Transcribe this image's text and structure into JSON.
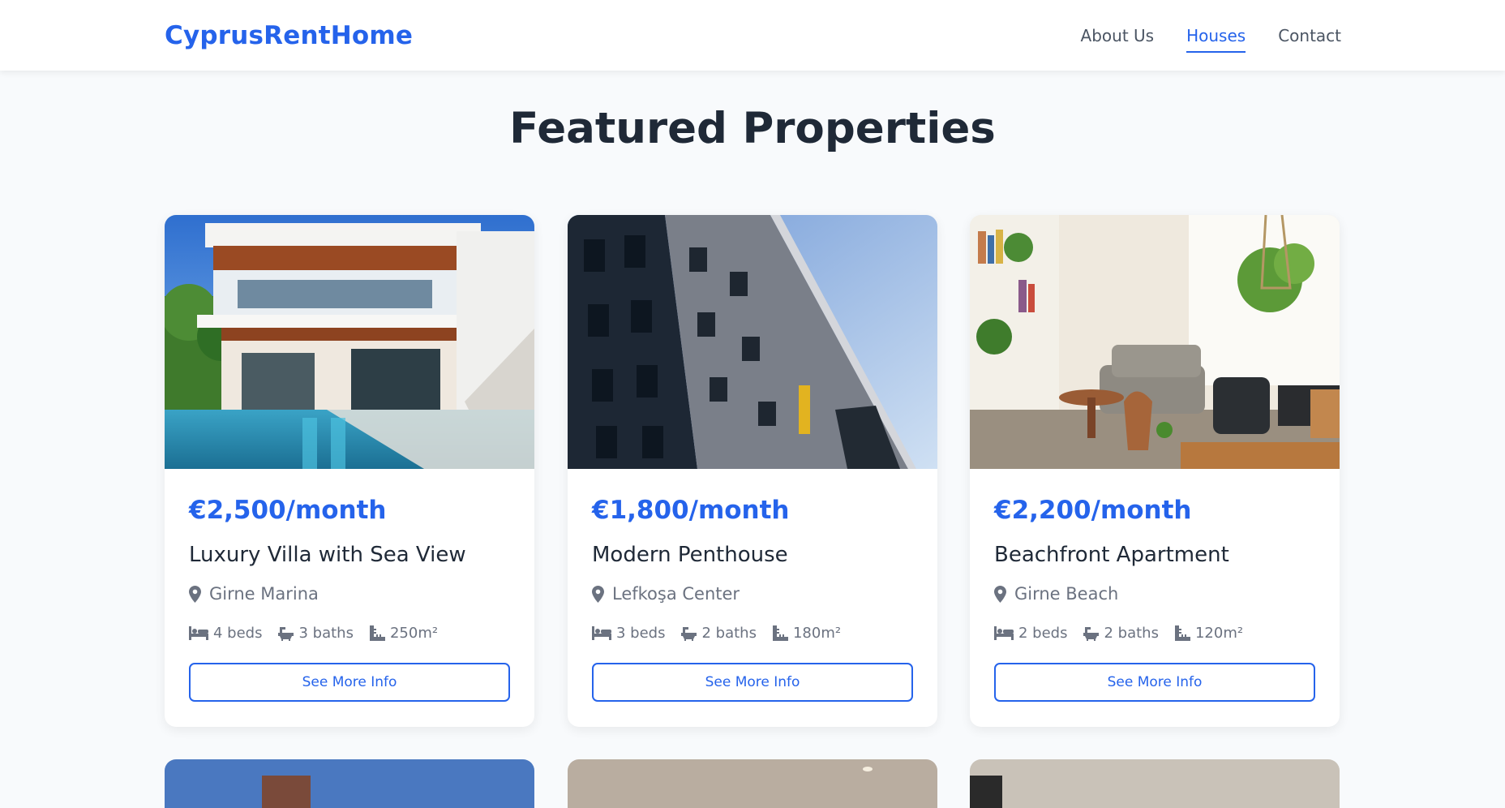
{
  "header": {
    "brand": "CyprusRentHome",
    "nav": [
      {
        "label": "About Us",
        "active": false
      },
      {
        "label": "Houses",
        "active": true
      },
      {
        "label": "Contact",
        "active": false
      }
    ]
  },
  "main": {
    "title": "Featured Properties",
    "properties": [
      {
        "price": "€2,500/month",
        "title": "Luxury Villa with Sea View",
        "location": "Girne Marina",
        "beds": "4 beds",
        "baths": "3 baths",
        "area": "250m²",
        "button": "See More Info"
      },
      {
        "price": "€1,800/month",
        "title": "Modern Penthouse",
        "location": "Lefkoşa Center",
        "beds": "3 beds",
        "baths": "2 baths",
        "area": "180m²",
        "button": "See More Info"
      },
      {
        "price": "€2,200/month",
        "title": "Beachfront Apartment",
        "location": "Girne Beach",
        "beds": "2 beds",
        "baths": "2 baths",
        "area": "120m²",
        "button": "See More Info"
      }
    ]
  },
  "colors": {
    "accent": "#2563eb",
    "text": "#1f2937",
    "muted": "#6b7280",
    "background": "#f8fafc"
  },
  "icons": {
    "location": "map-pin-icon",
    "beds": "bed-icon",
    "baths": "bath-icon",
    "area": "ruler-icon"
  }
}
